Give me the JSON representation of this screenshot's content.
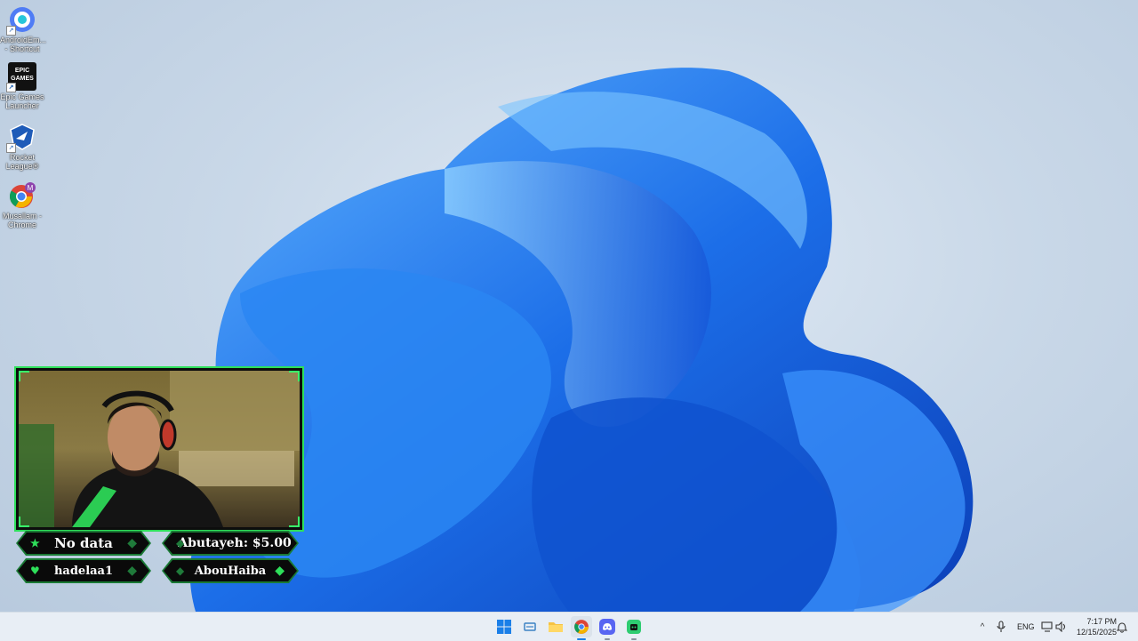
{
  "desktop": {
    "icons": [
      {
        "label": "AndroidEm... - Shortcut",
        "icon": "android-emulator-icon"
      },
      {
        "label": "Epic Games Launcher",
        "icon": "epic-games-icon",
        "logo_text": "EPIC GAMES"
      },
      {
        "label": "Rocket League®",
        "icon": "rocket-league-icon"
      },
      {
        "label": "Musallam - Chrome",
        "icon": "chrome-profile-icon",
        "profile_initial": "M"
      }
    ]
  },
  "stream_overlay": {
    "badges": [
      {
        "text": "No data",
        "icon": "star-icon"
      },
      {
        "text": "Abutayeh: $5.00",
        "icon": "diamond-icon"
      },
      {
        "text": "hadelaa1",
        "icon": "heart-icon"
      },
      {
        "text": "AbouHaiba",
        "icon": "diamond-icon"
      }
    ],
    "accent": "#2ee05a"
  },
  "taskbar": {
    "apps": [
      "start-icon",
      "task-view-icon",
      "file-explorer-icon",
      "chrome-icon",
      "discord-icon",
      "app-icon"
    ],
    "tray": {
      "language": "ENG",
      "time": "7:17 PM",
      "date": "12/15/2025"
    }
  },
  "colors": {
    "wallpaper_bloom": "#1c6ee8",
    "taskbar_bg": "#e8eef5"
  }
}
